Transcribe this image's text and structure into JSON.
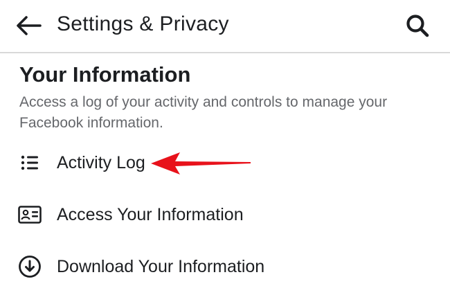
{
  "header": {
    "title": "Settings & Privacy",
    "back_icon": "arrow-left-icon",
    "search_icon": "search-icon"
  },
  "section": {
    "title": "Your Information",
    "description": "Access a log of your activity and controls to manage your Facebook information."
  },
  "menu": [
    {
      "label": "Activity Log",
      "icon": "list-icon"
    },
    {
      "label": "Access Your Information",
      "icon": "id-card-icon"
    },
    {
      "label": "Download Your Information",
      "icon": "download-circle-icon"
    }
  ],
  "annotation": {
    "arrow_color": "#e8121b"
  }
}
